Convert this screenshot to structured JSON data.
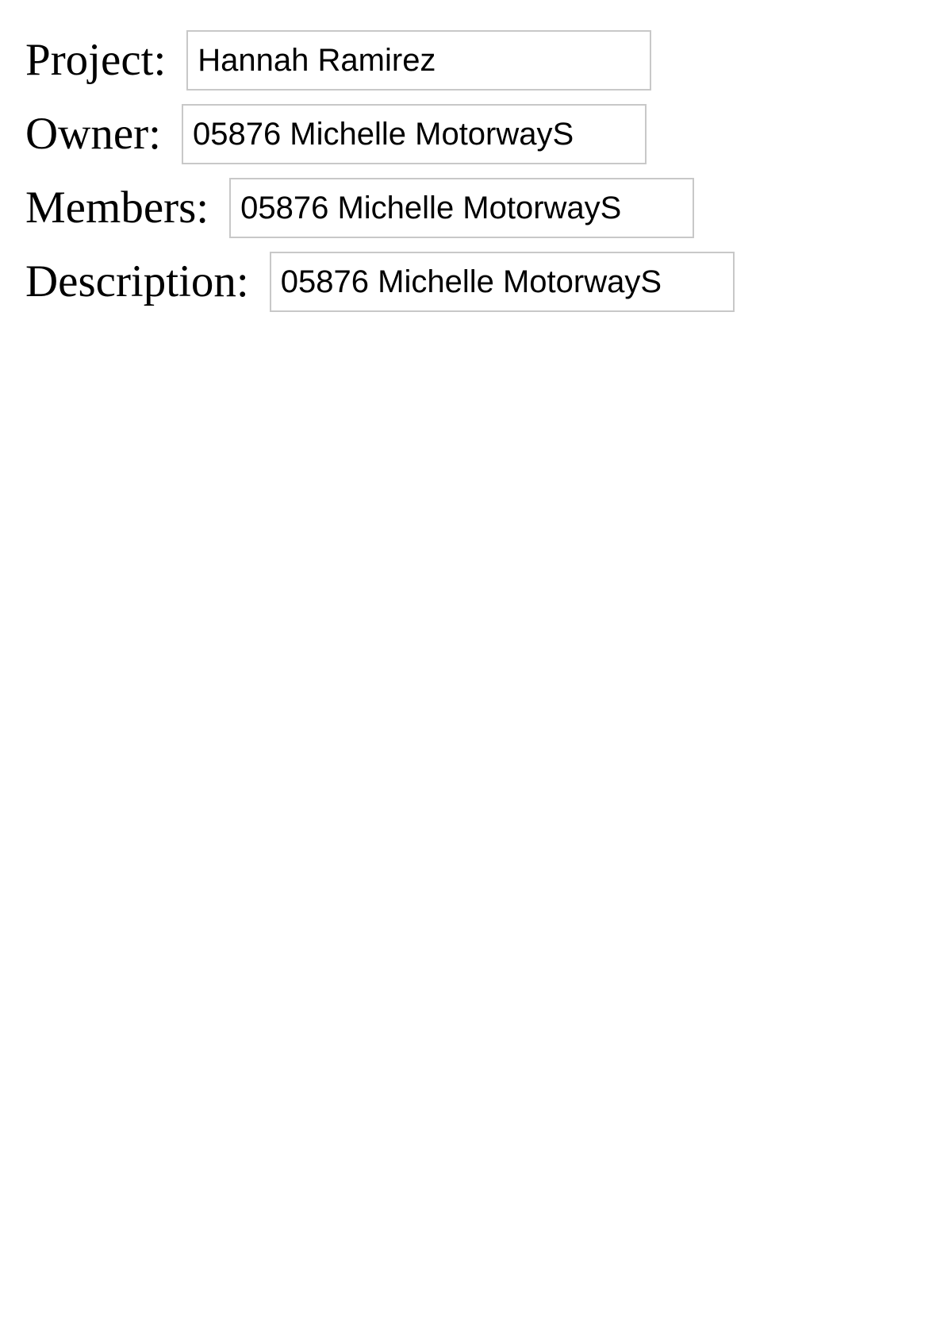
{
  "form": {
    "fields": [
      {
        "label": "Project:",
        "value": "Hannah Ramirez"
      },
      {
        "label": "Owner:",
        "value": "05876 Michelle MotorwayS"
      },
      {
        "label": "Members:",
        "value": "05876 Michelle MotorwayS"
      },
      {
        "label": "Description:",
        "value": "05876 Michelle MotorwayS"
      }
    ]
  }
}
